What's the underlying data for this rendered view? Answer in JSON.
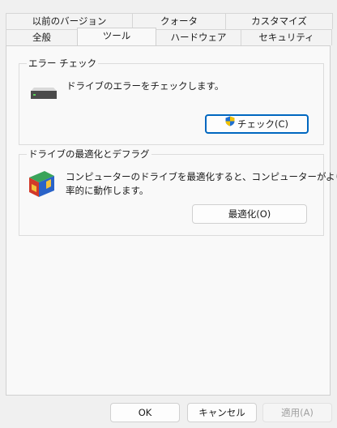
{
  "tabs": {
    "row1": [
      {
        "label": "以前のバージョン"
      },
      {
        "label": "クォータ"
      },
      {
        "label": "カスタマイズ"
      }
    ],
    "row2": [
      {
        "label": "全般"
      },
      {
        "label": "ツール",
        "active": true
      },
      {
        "label": "ハードウェア"
      },
      {
        "label": "セキュリティ"
      }
    ]
  },
  "error_check": {
    "title": "エラー チェック",
    "description": "ドライブのエラーをチェックします。",
    "button_label": "チェック(C)",
    "icon": "drive-icon"
  },
  "optimize": {
    "title": "ドライブの最適化とデフラグ",
    "description_line1": "コンピューターのドライブを最適化すると、コンピューターがより効",
    "description_line2": "率的に動作します。",
    "button_label": "最適化(O)",
    "icon": "defrag-icon"
  },
  "footer": {
    "ok_label": "OK",
    "cancel_label": "キャンセル",
    "apply_label": "適用(A)"
  },
  "colors": {
    "accent": "#0067c0",
    "shield_blue": "#1e6fd0",
    "shield_yellow": "#f2c200"
  }
}
